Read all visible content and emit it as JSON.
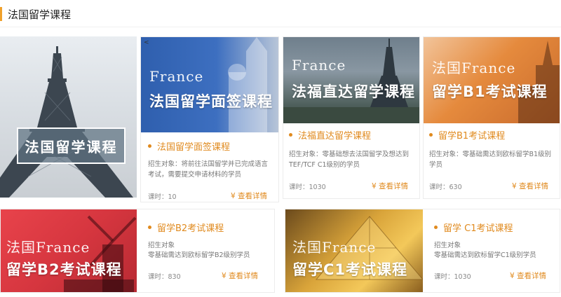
{
  "section": {
    "title": "法国留学课程"
  },
  "hero": {
    "title": "法国留学课程"
  },
  "nav": {
    "prev": "<"
  },
  "courses": [
    {
      "thumb_word": "France",
      "thumb_title": "法国留学面签课程",
      "title": "法国留学面签课程",
      "desc": "招生对象：将前往法国留学并已完成语言考试，需要提交申请材料的学员",
      "hours": "课时：10",
      "detail": "¥ 查看详情"
    },
    {
      "thumb_word": "France",
      "thumb_title": "法福直达留学课程",
      "title": "法福直达留学课程",
      "desc": "招生对象：零基础想去法国留学及想达到TEF/TCF C1级别的学员",
      "hours": "课时：1030",
      "detail": "¥ 查看详情"
    },
    {
      "thumb_word": "法国France",
      "thumb_title": "留学B1考试课程",
      "title": "留学B1考试课程",
      "desc": "招生对象：零基础需达到欧标留学B1级别学员",
      "hours": "课时：630",
      "detail": "¥ 查看详情"
    },
    {
      "thumb_word": "法国France",
      "thumb_title": "留学B2考试课程",
      "title": "留学B2考试课程",
      "desc_label": "招生对象",
      "desc": "零基础需达到欧标留学B2级别学员",
      "hours": "课时：830",
      "detail": "¥ 查看详情"
    },
    {
      "thumb_word": "法国France",
      "thumb_title": "留学C1考试课程",
      "title": "留学 C1考试课程",
      "desc_label": "招生对象",
      "desc": "零基础需达到欧标留学C1级别学员",
      "hours": "课时：1030",
      "detail": "¥ 查看详情"
    }
  ],
  "colors": {
    "accent": "#e08a1e",
    "header_bar": "#f0a12b"
  }
}
